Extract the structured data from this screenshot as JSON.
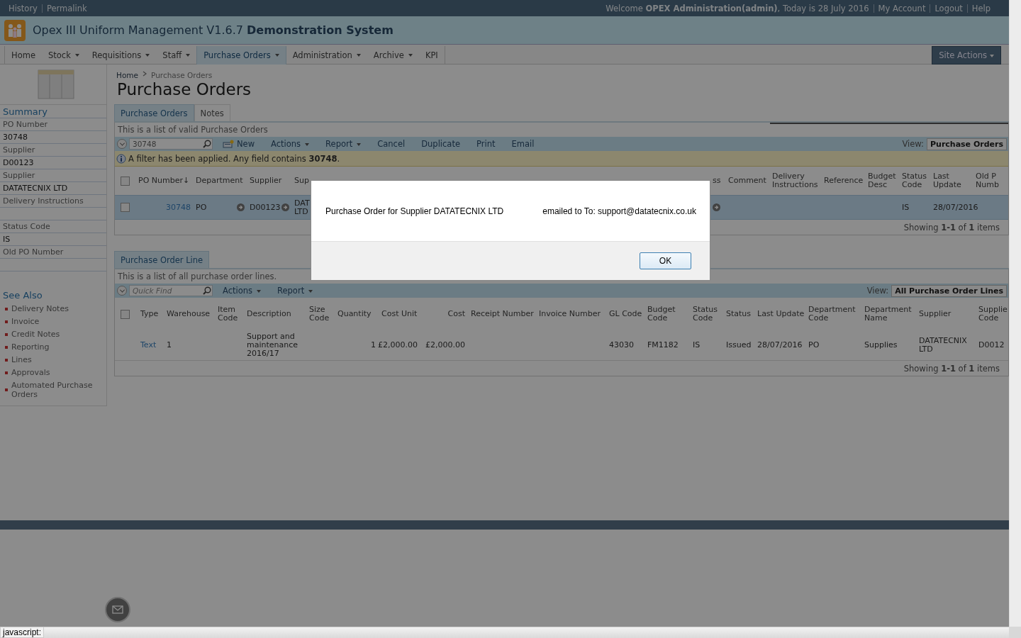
{
  "top_bar": {
    "links": [
      "History",
      "Permalink"
    ],
    "welcome": "Welcome **OPEX Administration(admin)**, Today is 28 July 2016",
    "account_links": [
      "My Account",
      "Logout",
      "Help"
    ]
  },
  "header": {
    "title": "Opex III Uniform Management V1.6.7 **Demonstration System**"
  },
  "nav": {
    "items": [
      {
        "label": "Home",
        "dropdown": false,
        "selected": false
      },
      {
        "label": "Stock",
        "dropdown": true,
        "selected": false
      },
      {
        "label": "Requisitions",
        "dropdown": true,
        "selected": false
      },
      {
        "label": "Staff",
        "dropdown": true,
        "selected": false
      },
      {
        "label": "Purchase Orders",
        "dropdown": true,
        "selected": true
      },
      {
        "label": "Administration",
        "dropdown": true,
        "selected": false
      },
      {
        "label": "Archive",
        "dropdown": true,
        "selected": false
      },
      {
        "label": "KPI",
        "dropdown": false,
        "selected": false
      }
    ],
    "site_actions": "Site Actions"
  },
  "sidebar": {
    "summary_title": "Summary",
    "fields": [
      {
        "label": "PO Number",
        "value": "30748"
      },
      {
        "label": "Supplier",
        "value": "D00123"
      },
      {
        "label": "Supplier",
        "value": "DATATECNIX LTD"
      },
      {
        "label": "Delivery Instructions"
      },
      {
        "label": "Status Code",
        "value": "IS"
      },
      {
        "label": "Old PO Number"
      }
    ],
    "see_also_title": "See Also",
    "links": [
      "Delivery Notes",
      "Invoice",
      "Credit Notes",
      "Reporting",
      "Lines",
      "Approvals",
      "Automated Purchase Orders"
    ]
  },
  "breadcrumb": [
    "Home",
    "Purchase Orders"
  ],
  "page_title": "Purchase Orders",
  "orders_panel": {
    "tabs": [
      {
        "label": "Purchase Orders",
        "selected": true
      },
      {
        "label": "Notes",
        "selected": false
      }
    ],
    "description": "This is a list of valid Purchase Orders",
    "search_value": "30748",
    "toolbar": [
      {
        "label": "New",
        "kind": "new"
      },
      {
        "label": "Actions",
        "kind": "menu"
      },
      {
        "label": "Report",
        "kind": "menu"
      },
      {
        "label": "Cancel",
        "kind": "plain"
      },
      {
        "label": "Duplicate",
        "kind": "plain"
      },
      {
        "label": "Print",
        "kind": "plain"
      },
      {
        "label": "Email",
        "kind": "plain"
      }
    ],
    "view_label": "View:",
    "view_value": "Purchase Orders",
    "filter_notice": "A filter has been applied. Any field contains **30748**.",
    "header_checked": false,
    "columns": [
      "PO Number↓",
      "Department",
      "Supplier",
      "Sup",
      "ss",
      "Comment",
      "Delivery Instructions",
      "Reference",
      "Budget Desc",
      "Status Code",
      "Last Update",
      "Old P Numb"
    ],
    "rows": [
      {
        "checked": false,
        "selected": true,
        "cells": [
          {
            "text": "30748",
            "kind": "link"
          },
          {
            "text": "PO",
            "lookup": true
          },
          {
            "text": "D00123",
            "lookup": true
          },
          {
            "text": "DAT LTD"
          },
          {
            "lookup": true
          },
          {},
          {},
          {},
          {},
          {
            "text": "IS"
          },
          {
            "text": "28/07/2016"
          },
          {}
        ]
      }
    ],
    "footer": "Showing **1-1** of **1** items"
  },
  "lines_panel": {
    "tabs": [
      {
        "label": "Purchase Order Line",
        "selected": true
      }
    ],
    "description": "This is a list of all purchase order lines.",
    "search_placeholder": "Quick Find",
    "toolbar": [
      {
        "label": "Actions",
        "kind": "menu"
      },
      {
        "label": "Report",
        "kind": "menu"
      }
    ],
    "view_label": "View:",
    "view_value": "All Purchase Order Lines",
    "header_checked": false,
    "columns": [
      "Type",
      "Warehouse",
      "Item Code",
      "Description",
      "Size Code",
      "Quantity",
      "Cost Unit",
      "Cost",
      "Receipt Number",
      "Invoice Number",
      "GL Code",
      "Budget Code",
      "Status Code",
      "Status",
      "Last Update",
      "Department Code",
      "Department Name",
      "Supplier",
      "Supplie Code"
    ],
    "rows": [
      {
        "checked": false,
        "selected": false,
        "cells": [
          {
            "text": "Text",
            "kind": "link"
          },
          {
            "text": "1"
          },
          {},
          {
            "text": "Support and maintenance 2016/17"
          },
          {},
          {
            "text": "1"
          },
          {
            "text": "£2,000.00"
          },
          {
            "text": "£2,000.00"
          },
          {},
          {},
          {
            "text": "43030"
          },
          {
            "text": "FM1182"
          },
          {
            "text": "IS"
          },
          {
            "text": "Issued"
          },
          {
            "text": "28/07/2016"
          },
          {
            "text": "PO"
          },
          {
            "text": "Supplies"
          },
          {
            "text": "DATATECNIX LTD"
          },
          {
            "text": "D0012"
          }
        ]
      }
    ],
    "footer": "Showing **1-1** of **1** items"
  },
  "dialog": {
    "message": "Purchase Order for Supplier DATATECNIX LTD",
    "recipient": "emailed to To: support@datatecnix.co.uk",
    "button": "OK"
  },
  "status_text": "javascript:"
}
